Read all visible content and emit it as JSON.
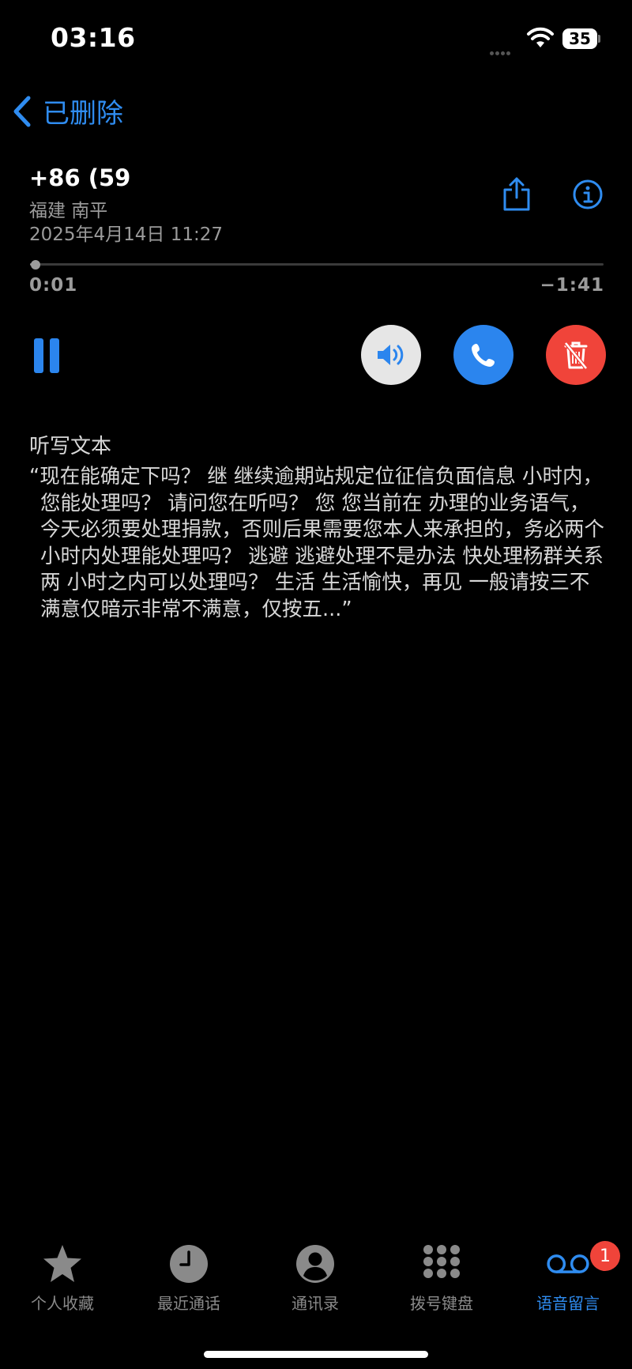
{
  "status_bar": {
    "time": "03:16",
    "battery": "35"
  },
  "nav": {
    "back_label": "已删除"
  },
  "voicemail": {
    "caller": "+86 (59",
    "location": "福建 南平",
    "datetime": "2025年4月14日 11:27",
    "elapsed": "0:01",
    "remaining": "−1:41",
    "progress_fraction": 0.01
  },
  "transcript": {
    "heading": "听写文本",
    "text": "“现在能确定下吗？ 继 继续逾期站规定位征信负面信息 小时内，您能处理吗？ 请问您在听吗？ 您 您当前在 办理的业务语气，今天必须要处理捐款，否则后果需要您本人来承担的，务必两个小时内处理能处理吗？ 逃避 逃避处理不是办法 快处理杨群关系 两 小时之内可以处理吗？ 生活 生活愉快，再见 一般请按三不满意仅暗示非常不满意，仅按五...”"
  },
  "tabs": [
    {
      "label": "个人收藏",
      "icon": "star-icon"
    },
    {
      "label": "最近通话",
      "icon": "clock-icon"
    },
    {
      "label": "通讯录",
      "icon": "person-icon"
    },
    {
      "label": "拨号键盘",
      "icon": "keypad-icon"
    },
    {
      "label": "语音留言",
      "icon": "voicemail-icon",
      "active": true,
      "badge": "1"
    }
  ],
  "colors": {
    "accent": "#2f8cf0",
    "destructive": "#f0443a",
    "secondary_text": "#9b9b9b"
  }
}
